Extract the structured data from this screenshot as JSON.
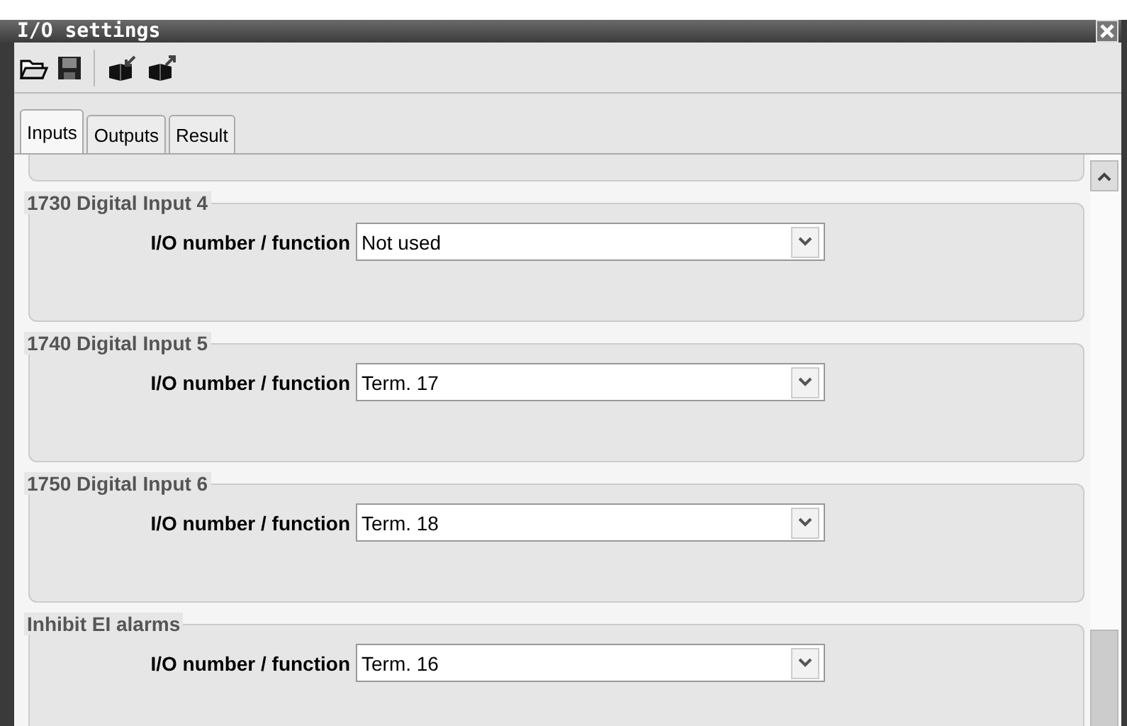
{
  "window": {
    "title": "I/O settings"
  },
  "tabs": [
    {
      "label": "Inputs",
      "selected": true
    },
    {
      "label": "Outputs",
      "selected": false
    },
    {
      "label": "Result",
      "selected": false
    }
  ],
  "groups": [
    {
      "title": "1730 Digital Input 4",
      "label": "I/O number / function",
      "value": "Not used"
    },
    {
      "title": "1740 Digital Input 5",
      "label": "I/O number / function",
      "value": "Term. 17"
    },
    {
      "title": "1750 Digital Input 6",
      "label": "I/O number / function",
      "value": "Term. 18"
    },
    {
      "title": "Inhibit EI alarms",
      "label": "I/O number / function",
      "value": "Term. 16"
    }
  ]
}
